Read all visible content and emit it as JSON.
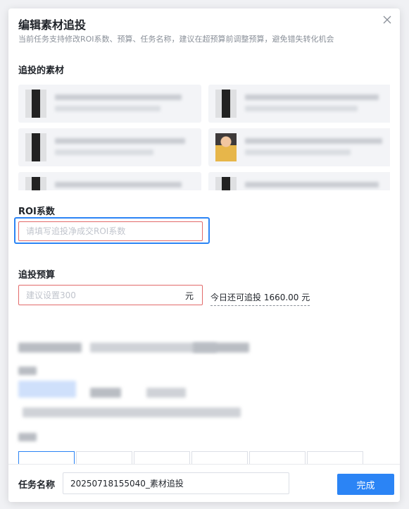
{
  "dialog": {
    "title": "编辑素材追投",
    "subtitle": "当前任务支持修改ROI系数、预算、任务名称，建议在超预算前调整预算，避免错失转化机会",
    "close_icon": "close-icon"
  },
  "materials": {
    "label": "追投的素材"
  },
  "roi": {
    "label": "ROI系数",
    "placeholder": "请填写追投净成交ROI系数",
    "value": ""
  },
  "budget": {
    "label": "追投预算",
    "placeholder": "建议设置300",
    "unit": "元",
    "value": "",
    "today_remaining": "今日还可追投 1660.00 元"
  },
  "footer": {
    "task_name_label": "任务名称",
    "task_name_value": "20250718155040_素材追投",
    "done_label": "完成"
  },
  "colors": {
    "primary": "#2b84f5",
    "error_border": "#e26a6a"
  }
}
